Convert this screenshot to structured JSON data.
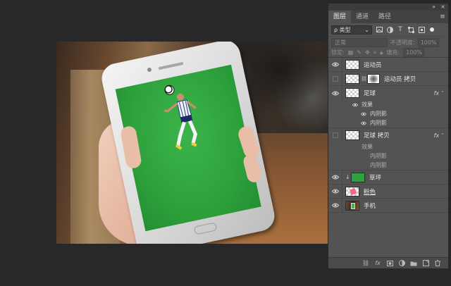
{
  "panel": {
    "collapse_glyph": "»",
    "menu_glyph": "×",
    "tabs": [
      {
        "label": "图层",
        "active": true
      },
      {
        "label": "通道",
        "active": false
      },
      {
        "label": "路径",
        "active": false
      }
    ],
    "tab_menu_glyph": "≡",
    "filter": {
      "label": "ρ 类型",
      "icons": [
        "image-filter-icon",
        "adjustment-filter-icon",
        "type-filter-icon",
        "shape-filter-icon",
        "smart-object-filter-icon"
      ]
    },
    "blend_mode": "正常",
    "opacity_label": "不透明度:",
    "opacity_value": "100%",
    "lock_label": "锁定:",
    "fill_label": "填充:",
    "fill_value": "100%"
  },
  "layers": [
    {
      "name": "运动员",
      "visible": true,
      "thumb": "checker"
    },
    {
      "name": "运动员 拷贝",
      "visible": false,
      "thumb": "checker",
      "mask": true
    },
    {
      "name": "足球",
      "visible": true,
      "thumb": "checker",
      "fx": "fx",
      "effects_label": "效果",
      "effects": [
        "内阴影",
        "内阴影"
      ]
    },
    {
      "name": "足球 拷贝",
      "visible": false,
      "thumb": "checker",
      "fx": "fx",
      "effects_label": "效果",
      "effects": [
        "内阴影",
        "内阴影"
      ]
    },
    {
      "name": "草坪",
      "visible": true,
      "thumb": "green",
      "clipped": true
    },
    {
      "name": "粉色",
      "visible": true,
      "thumb": "pink"
    },
    {
      "name": "手机",
      "visible": true,
      "thumb": "photo"
    }
  ],
  "bottom_icons": [
    "link-layers-icon",
    "fx-icon",
    "add-mask-icon",
    "adjustment-layer-icon",
    "new-group-icon",
    "new-layer-icon",
    "delete-layer-icon"
  ],
  "colors": {
    "panel_bg": "#535353",
    "app_bg": "#282828",
    "grass": "#2ea23c"
  }
}
